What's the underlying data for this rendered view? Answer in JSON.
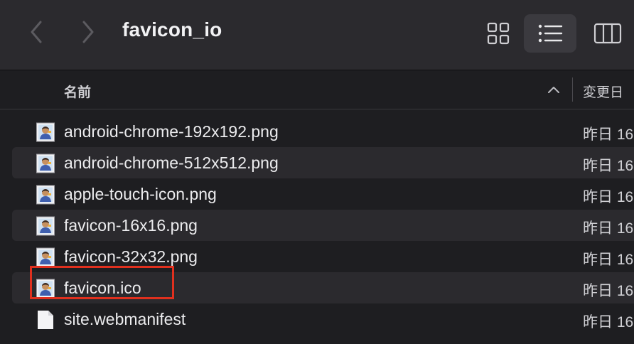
{
  "toolbar": {
    "title": "favicon_io",
    "back_icon": "chevron-left-icon",
    "forward_icon": "chevron-right-icon",
    "view_icons": [
      "grid-view-icon",
      "list-view-icon",
      "column-view-icon"
    ],
    "active_view": "list-view-icon"
  },
  "header": {
    "name_label": "名前",
    "date_label": "変更日",
    "sort_icon": "chevron-up-icon"
  },
  "files": [
    {
      "name": "android-chrome-192x192.png",
      "date": "昨日 16",
      "icon": "image-thumbnail-icon"
    },
    {
      "name": "android-chrome-512x512.png",
      "date": "昨日 16",
      "icon": "image-thumbnail-icon"
    },
    {
      "name": "apple-touch-icon.png",
      "date": "昨日 16",
      "icon": "image-thumbnail-icon"
    },
    {
      "name": "favicon-16x16.png",
      "date": "昨日 16",
      "icon": "image-thumbnail-icon"
    },
    {
      "name": "favicon-32x32.png",
      "date": "昨日 16",
      "icon": "image-thumbnail-icon"
    },
    {
      "name": "favicon.ico",
      "date": "昨日 16",
      "icon": "image-thumbnail-icon"
    },
    {
      "name": "site.webmanifest",
      "date": "昨日 16",
      "icon": "document-icon"
    }
  ],
  "highlighted_file": "favicon.ico",
  "colors": {
    "toolbar_bg": "#2b2a2e",
    "list_bg": "#1e1e21",
    "alt_row": "#2b2a2e",
    "highlight": "#e0301e"
  }
}
